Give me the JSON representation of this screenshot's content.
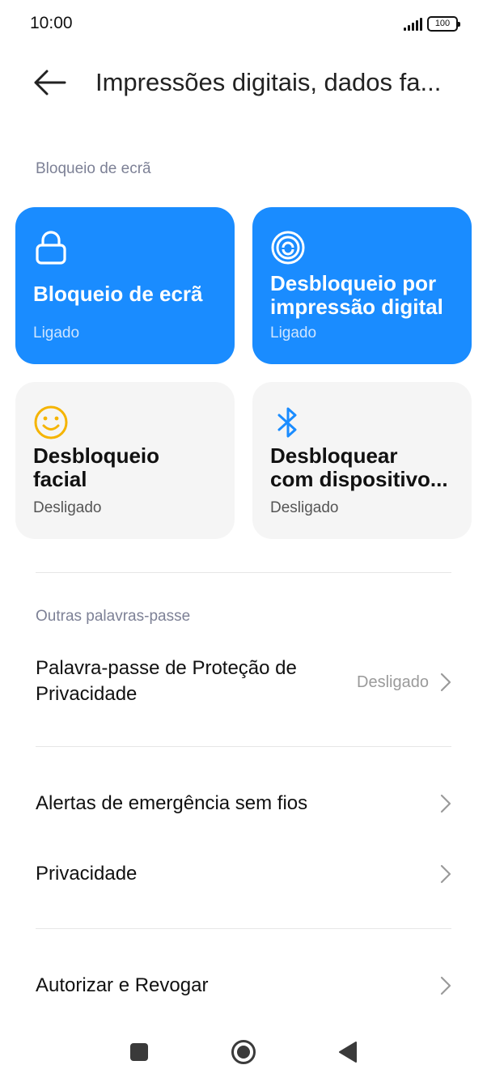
{
  "status_bar": {
    "time": "10:00",
    "battery": "100"
  },
  "header": {
    "title": "Impressões digitais, dados fa..."
  },
  "sections": {
    "screen_lock": "Bloqueio de ecrã",
    "other_passwords": "Outras palavras-passe"
  },
  "tiles": [
    {
      "line1": "Bloqueio de ecrã",
      "line2": "",
      "status": "Ligado",
      "icon": "lock-icon",
      "state": "on"
    },
    {
      "line1": "Desbloqueio por",
      "line2": "impressão digital",
      "status": "Ligado",
      "icon": "fingerprint-icon",
      "state": "on"
    },
    {
      "line1": "Desbloqueio",
      "line2": "facial",
      "status": "Desligado",
      "icon": "smiley-face-icon",
      "state": "off"
    },
    {
      "line1": "Desbloquear",
      "line2": "com dispositivo...",
      "status": "Desligado",
      "icon": "bluetooth-icon",
      "state": "off"
    }
  ],
  "rows": {
    "privacy_password": {
      "line1": "Palavra-passe de Proteção de",
      "line2": "Privacidade",
      "value": "Desligado"
    },
    "emergency_alerts": {
      "label": "Alertas de emergência sem fios"
    },
    "privacy": {
      "label": "Privacidade"
    },
    "authorize": {
      "label": "Autorizar e Revogar"
    }
  },
  "colors": {
    "accent": "#1a8cff",
    "tile_off": "#f5f5f5",
    "section_label": "#7d8196",
    "face_icon": "#f5b400"
  }
}
